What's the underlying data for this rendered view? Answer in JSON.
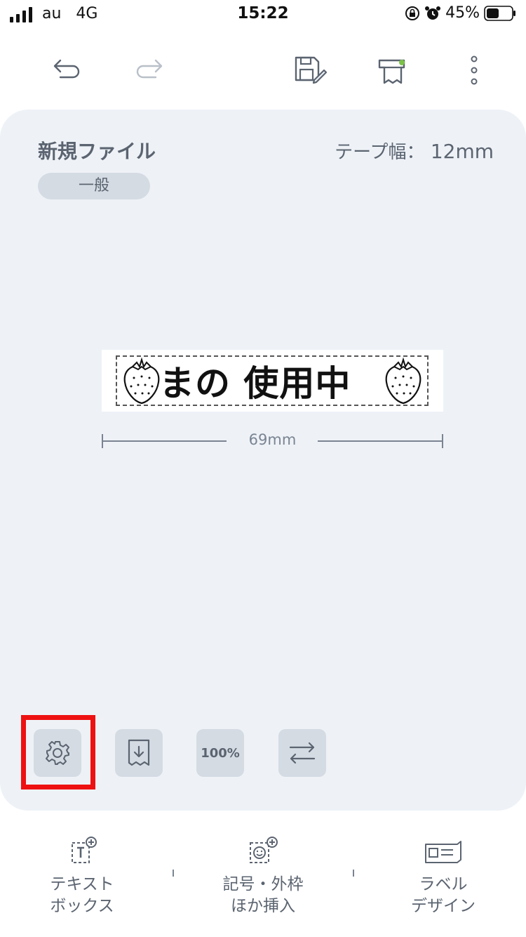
{
  "status_bar": {
    "carrier": "au",
    "network": "4G",
    "time": "15:22",
    "battery_percent": "45%"
  },
  "toolbar": {
    "undo_icon": "undo-icon",
    "redo_icon": "redo-icon",
    "save_icon": "save-edit-icon",
    "print_icon": "printer-icon",
    "more_icon": "more-vertical-icon"
  },
  "document": {
    "title": "新規ファイル",
    "tape_width_label": "テープ幅：",
    "tape_width_value": "12mm",
    "category": "一般"
  },
  "label": {
    "text": "まの 使用中",
    "length": "69mm"
  },
  "tools": {
    "settings_icon": "gear-icon",
    "feed_icon": "tape-feed-icon",
    "zoom_label": "100%",
    "swap_icon": "swap-arrows-icon"
  },
  "bottom_nav": {
    "items": [
      {
        "label_line1": "テキスト",
        "label_line2": "ボックス",
        "icon": "text-box-add-icon"
      },
      {
        "label_line1": "記号・外枠",
        "label_line2": "ほか挿入",
        "icon": "symbol-add-icon"
      },
      {
        "label_line1": "ラベル",
        "label_line2": "デザイン",
        "icon": "label-design-icon"
      }
    ]
  },
  "colors": {
    "panel_bg": "#eef2f7",
    "button_bg": "#d4dbe3",
    "text": "#5b6470",
    "highlight": "#ee1111"
  }
}
